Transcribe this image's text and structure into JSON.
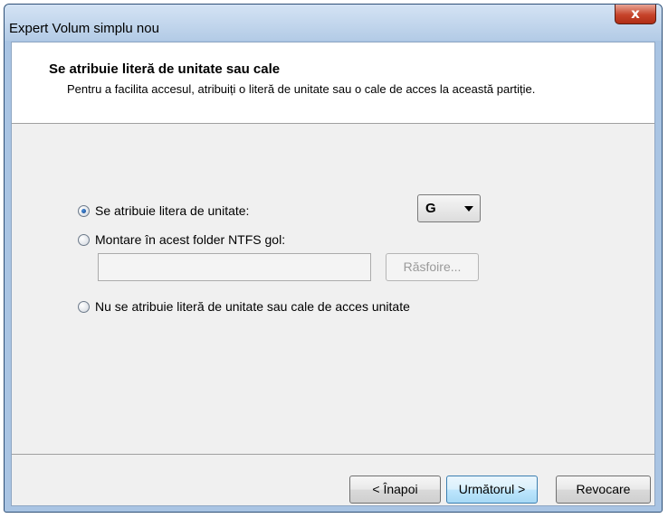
{
  "window": {
    "title": "Expert Volum simplu nou",
    "close_glyph": "x"
  },
  "header": {
    "title": "Se atribuie literă de unitate sau cale",
    "description": "Pentru a facilita accesul, atribuiți o literă de unitate sau o cale de acces la această partiție."
  },
  "options": {
    "assign_letter": {
      "label": "Se atribuie litera de unitate:",
      "checked": true
    },
    "drive_letter": {
      "selected": "G"
    },
    "mount_folder": {
      "label": "Montare în acest folder NTFS gol:",
      "checked": false
    },
    "folder_path": {
      "value": ""
    },
    "browse_label": "Răsfoire...",
    "no_assign": {
      "label": "Nu se atribuie literă de unitate sau cale de acces unitate",
      "checked": false
    }
  },
  "footer": {
    "back_label": "< Înapoi",
    "next_label": "Următorul >",
    "cancel_label": "Revocare"
  },
  "colors": {
    "title_bar": "#b3cbe6",
    "close_button": "#c6432a",
    "default_button_border": "#3c7fb1"
  }
}
